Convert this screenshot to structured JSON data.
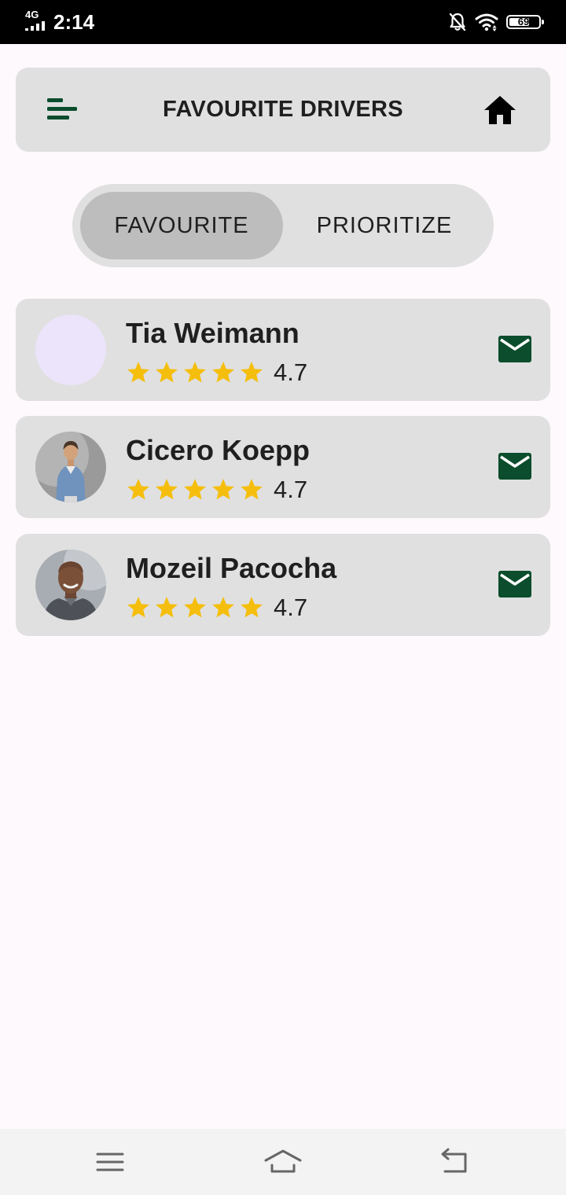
{
  "status_bar": {
    "network": "4G",
    "time": "2:14",
    "battery_percent": "69",
    "battery_level": 0.69,
    "icons": [
      "signal-bars-icon",
      "notifications-off-icon",
      "wifi-icon",
      "battery-icon"
    ]
  },
  "header": {
    "title": "FAVOURITE DRIVERS",
    "menu_icon": "menu-icon",
    "home_icon": "home-icon"
  },
  "tabs": {
    "items": [
      {
        "label": "FAVOURITE",
        "selected": true
      },
      {
        "label": "PRIORITIZE",
        "selected": false
      }
    ]
  },
  "drivers": [
    {
      "name": "Tia Weimann",
      "rating": "4.7",
      "stars": 5,
      "avatar": "placeholder-avatar"
    },
    {
      "name": "Cicero Koepp",
      "rating": "4.7",
      "stars": 5,
      "avatar": "driver-photo"
    },
    {
      "name": "Mozeil Pacocha",
      "rating": "4.7",
      "stars": 5,
      "avatar": "driver-photo"
    }
  ],
  "colors": {
    "accent": "#0b4d2c",
    "star": "#f5be0c",
    "card_bg": "#e0e0e0",
    "selected_tab": "#bdbdbd",
    "placeholder_avatar": "#ece4fb"
  },
  "navigation_bar": {
    "icons": [
      "recent-apps-icon",
      "home-nav-icon",
      "back-icon"
    ]
  }
}
